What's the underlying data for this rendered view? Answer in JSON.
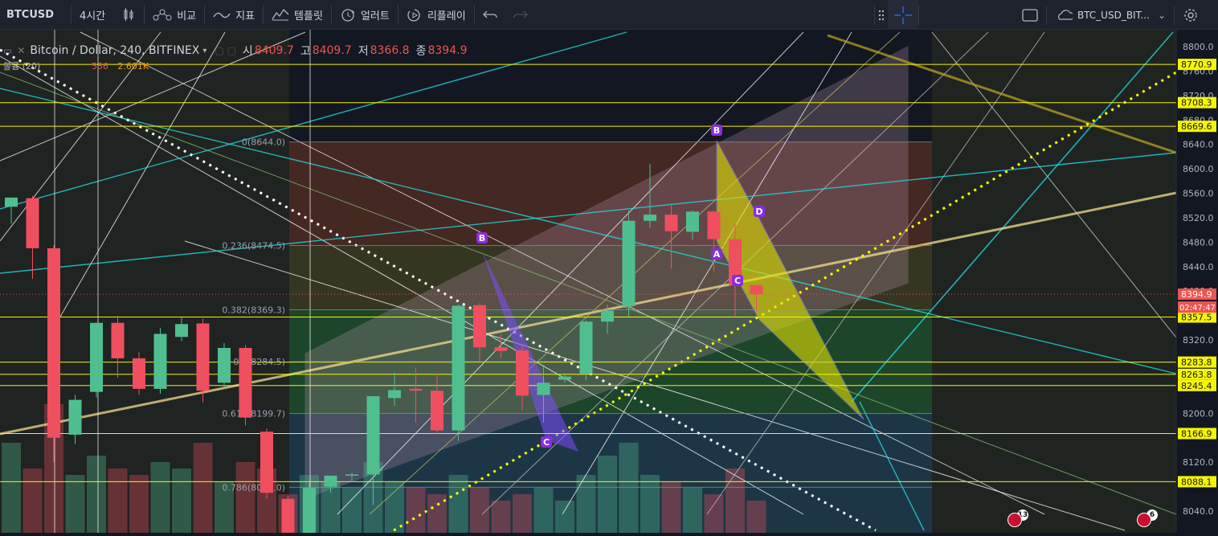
{
  "toolbar": {
    "symbol": "BTCUSD",
    "interval": "4시간",
    "compare": "비교",
    "indicators": "지표",
    "templates": "템플릿",
    "alert": "얼러트",
    "replay": "리플레이",
    "layout_name": "BTC_USD_BIT..."
  },
  "legend": {
    "title": "Bitcoin / Dollar, 240, BITFINEX",
    "open_label": "시",
    "open": "8409.7",
    "high_label": "고",
    "high": "8409.7",
    "low_label": "저",
    "low": "8366.8",
    "close_label": "종",
    "close": "8394.9"
  },
  "volume_legend": {
    "name": "볼륨 (20)",
    "v1": "536",
    "v2": "2.601K"
  },
  "badges": {
    "earnings": "13",
    "events": "6"
  },
  "colors": {
    "background": "#131722",
    "up": "#4fbf8f",
    "down": "#ef4f5f",
    "horizontal": "#f5f500",
    "dotted_white": "#ffffff",
    "dotted_yellow": "#ffff00",
    "cyan": "#22e3e8",
    "cream": "#f5dc8c",
    "olive": "#b8a020",
    "pattern_purple": "#7c4dff",
    "pattern_yellow": "#e0e000"
  },
  "chart_data": {
    "type": "candlestick",
    "y_axis": {
      "ylim": [
        8000,
        8820
      ],
      "ticks": [
        8040,
        8120,
        8200,
        8280,
        8320,
        8360,
        8400,
        8440,
        8480,
        8520,
        8560,
        8600,
        8640,
        8680,
        8720,
        8760,
        8800
      ],
      "tick_labels": [
        "8040.0",
        "8120.0",
        "8200.0",
        "8280.0",
        "8320.0",
        "8360.0",
        "8400.0",
        "8440.0",
        "8480.0",
        "8520.0",
        "8560.0",
        "8600.0",
        "8640.0",
        "8680.0",
        "8720.0",
        "8760.0",
        "8800.0"
      ]
    },
    "candles": [
      {
        "o": 8538,
        "h": 8552,
        "l": 8510,
        "c": 8553
      },
      {
        "o": 8552,
        "h": 8556,
        "l": 8420,
        "c": 8470
      },
      {
        "o": 8470,
        "h": 8475,
        "l": 8120,
        "c": 8160
      },
      {
        "o": 8165,
        "h": 8230,
        "l": 8150,
        "c": 8222
      },
      {
        "o": 8235,
        "h": 8348,
        "l": 8226,
        "c": 8348
      },
      {
        "o": 8348,
        "h": 8360,
        "l": 8258,
        "c": 8290
      },
      {
        "o": 8290,
        "h": 8300,
        "l": 8230,
        "c": 8240
      },
      {
        "o": 8240,
        "h": 8340,
        "l": 8232,
        "c": 8330
      },
      {
        "o": 8325,
        "h": 8357,
        "l": 8318,
        "c": 8346
      },
      {
        "o": 8347,
        "h": 8355,
        "l": 8218,
        "c": 8237
      },
      {
        "o": 8250,
        "h": 8315,
        "l": 8240,
        "c": 8307
      },
      {
        "o": 8307,
        "h": 8312,
        "l": 8180,
        "c": 8193
      },
      {
        "o": 8170,
        "h": 8175,
        "l": 8060,
        "c": 8070
      },
      {
        "o": 8060,
        "h": 8065,
        "l": 8000,
        "c": 8000
      },
      {
        "o": 8000,
        "h": 8090,
        "l": 7995,
        "c": 8078
      },
      {
        "o": 8080,
        "h": 8098,
        "l": 8070,
        "c": 8098
      },
      {
        "o": 8098,
        "h": 8103,
        "l": 8090,
        "c": 8100
      },
      {
        "o": 8100,
        "h": 8228,
        "l": 8050,
        "c": 8228
      },
      {
        "o": 8225,
        "h": 8267,
        "l": 8212,
        "c": 8238
      },
      {
        "o": 8240,
        "h": 8275,
        "l": 8185,
        "c": 8237
      },
      {
        "o": 8237,
        "h": 8265,
        "l": 8165,
        "c": 8172
      },
      {
        "o": 8172,
        "h": 8378,
        "l": 8155,
        "c": 8376
      },
      {
        "o": 8377,
        "h": 8380,
        "l": 8285,
        "c": 8308
      },
      {
        "o": 8308,
        "h": 8330,
        "l": 8290,
        "c": 8302
      },
      {
        "o": 8303,
        "h": 8310,
        "l": 8205,
        "c": 8229
      },
      {
        "o": 8230,
        "h": 8276,
        "l": 8185,
        "c": 8250
      },
      {
        "o": 8255,
        "h": 8266,
        "l": 8250,
        "c": 8260
      },
      {
        "o": 8265,
        "h": 8352,
        "l": 8254,
        "c": 8350
      },
      {
        "o": 8350,
        "h": 8378,
        "l": 8330,
        "c": 8368
      },
      {
        "o": 8375,
        "h": 8532,
        "l": 8358,
        "c": 8515
      },
      {
        "o": 8515,
        "h": 8608,
        "l": 8504,
        "c": 8525
      },
      {
        "o": 8525,
        "h": 8544,
        "l": 8437,
        "c": 8498
      },
      {
        "o": 8497,
        "h": 8532,
        "l": 8484,
        "c": 8530
      },
      {
        "o": 8530,
        "h": 8532,
        "l": 8432,
        "c": 8485
      },
      {
        "o": 8485,
        "h": 8510,
        "l": 8358,
        "c": 8410
      },
      {
        "o": 8410,
        "h": 8410,
        "l": 8367,
        "c": 8395
      }
    ],
    "volumes": [
      14,
      10,
      20,
      9,
      12,
      10,
      9,
      11,
      10,
      14,
      8,
      11,
      10,
      6,
      9,
      8,
      7,
      11,
      8,
      7,
      6,
      9,
      7,
      5,
      6,
      7,
      5,
      9,
      12,
      14,
      9,
      8,
      7,
      6,
      10,
      5
    ],
    "horizontal_levels": [
      {
        "value": 8770.9,
        "label": "8770.9"
      },
      {
        "value": 8708.3,
        "label": "8708.3"
      },
      {
        "value": 8669.6,
        "label": "8669.6"
      },
      {
        "value": 8357.5,
        "label": "8357.5"
      },
      {
        "value": 8283.8,
        "label": "8283.8"
      },
      {
        "value": 8263.8,
        "label": "8263.8"
      },
      {
        "value": 8245.4,
        "label": "8245.4"
      },
      {
        "value": 8166.9,
        "label": "8166.9"
      },
      {
        "value": 8088.1,
        "label": "8088.1"
      }
    ],
    "current_price": {
      "value": 8394.9,
      "label": "8394.9",
      "countdown": "02:47:47"
    },
    "fibonacci": [
      {
        "level": "0",
        "price": "8644.0",
        "value": 8644.0
      },
      {
        "level": "0.236",
        "price": "8474.5",
        "value": 8474.5
      },
      {
        "level": "0.382",
        "price": "8369.3",
        "value": 8369.3
      },
      {
        "level": "0.5",
        "price": "8284.5",
        "value": 8284.5
      },
      {
        "level": "0.618",
        "price": "8199.7",
        "value": 8199.7
      },
      {
        "level": "0.786",
        "price": "8079.0",
        "value": 8079.0
      }
    ],
    "pattern_labels": [
      "B",
      "C",
      "B",
      "A",
      "C",
      "D"
    ]
  }
}
